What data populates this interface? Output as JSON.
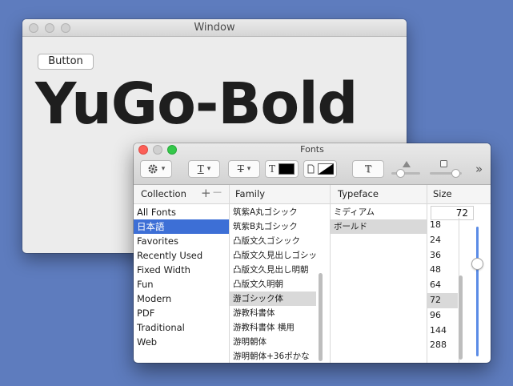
{
  "window": {
    "title": "Window",
    "button_label": "Button",
    "preview_text": "YuGo-Bold"
  },
  "fonts_panel": {
    "title": "Fonts",
    "toolbar": {
      "text_style_icon": "T",
      "strike_icon": "T",
      "text_color_icon": "T",
      "text_color": "#000000",
      "doc_color_icon": "document-icon",
      "shadow_icon": "T",
      "more_label": "»"
    },
    "headers": {
      "collection": "Collection",
      "add": "+",
      "remove": "—",
      "family": "Family",
      "typeface": "Typeface",
      "size": "Size"
    },
    "collections": [
      "All Fonts",
      "日本語",
      "Favorites",
      "Recently Used",
      "Fixed Width",
      "Fun",
      "Modern",
      "PDF",
      "Traditional",
      "Web"
    ],
    "selected_collection": "日本語",
    "families": [
      "筑紫A丸ゴシック",
      "筑紫B丸ゴシック",
      "凸版文久ゴシック",
      "凸版文久見出しゴシック",
      "凸版文久見出し明朝",
      "凸版文久明朝",
      "游ゴシック体",
      "游教科書体",
      "游教科書体 横用",
      "游明朝体",
      "游明朝体+36ポかな"
    ],
    "selected_family": "游ゴシック体",
    "typefaces": [
      "ミディアム",
      "ボールド"
    ],
    "selected_typeface": "ボールド",
    "size_value": "72",
    "sizes": [
      "18",
      "24",
      "36",
      "48",
      "64",
      "72",
      "96",
      "144",
      "288"
    ],
    "selected_size": "72",
    "accent_color": "#3d6fd6"
  }
}
